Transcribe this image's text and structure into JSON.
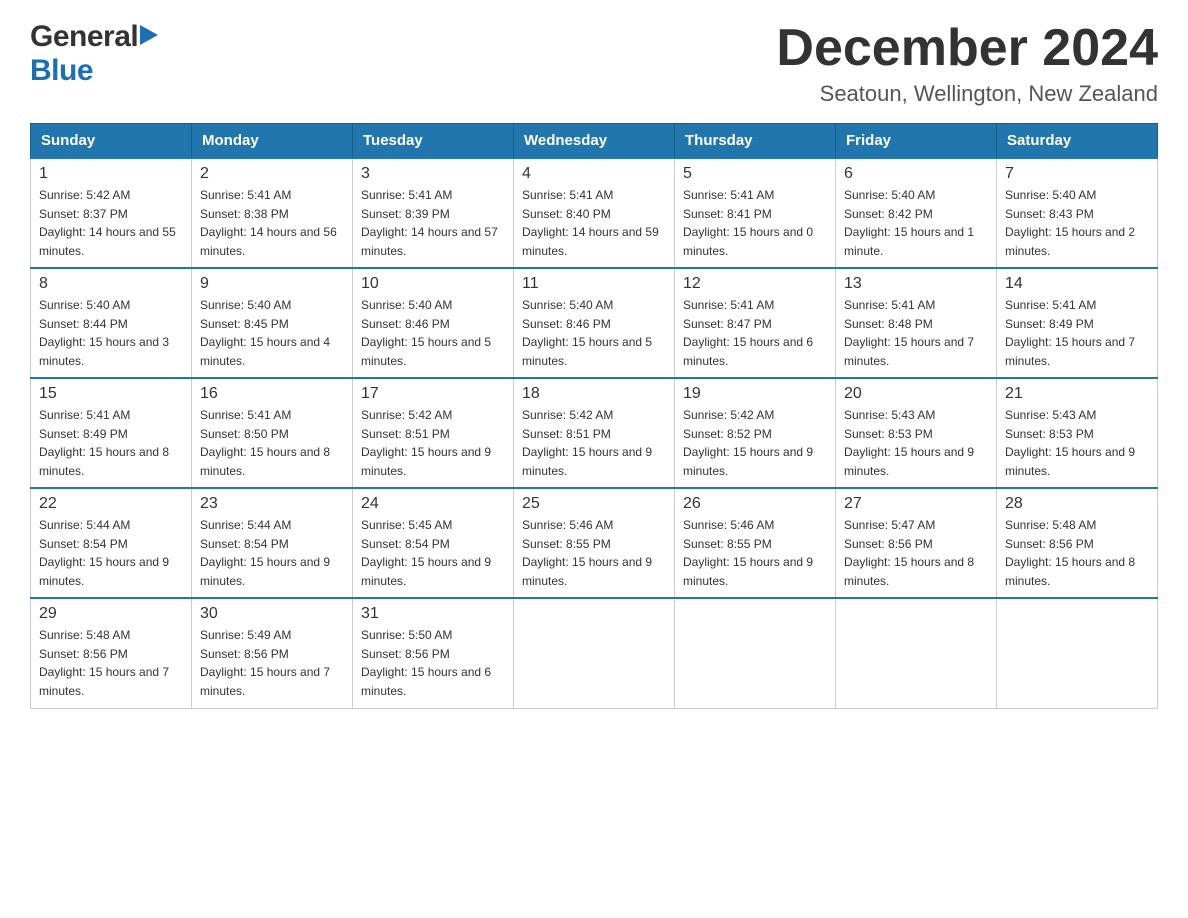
{
  "header": {
    "logo_general": "General",
    "logo_blue": "Blue",
    "month_title": "December 2024",
    "location": "Seatoun, Wellington, New Zealand"
  },
  "weekdays": [
    "Sunday",
    "Monday",
    "Tuesday",
    "Wednesday",
    "Thursday",
    "Friday",
    "Saturday"
  ],
  "weeks": [
    [
      {
        "day": "1",
        "sunrise": "5:42 AM",
        "sunset": "8:37 PM",
        "daylight": "14 hours and 55 minutes."
      },
      {
        "day": "2",
        "sunrise": "5:41 AM",
        "sunset": "8:38 PM",
        "daylight": "14 hours and 56 minutes."
      },
      {
        "day": "3",
        "sunrise": "5:41 AM",
        "sunset": "8:39 PM",
        "daylight": "14 hours and 57 minutes."
      },
      {
        "day": "4",
        "sunrise": "5:41 AM",
        "sunset": "8:40 PM",
        "daylight": "14 hours and 59 minutes."
      },
      {
        "day": "5",
        "sunrise": "5:41 AM",
        "sunset": "8:41 PM",
        "daylight": "15 hours and 0 minutes."
      },
      {
        "day": "6",
        "sunrise": "5:40 AM",
        "sunset": "8:42 PM",
        "daylight": "15 hours and 1 minute."
      },
      {
        "day": "7",
        "sunrise": "5:40 AM",
        "sunset": "8:43 PM",
        "daylight": "15 hours and 2 minutes."
      }
    ],
    [
      {
        "day": "8",
        "sunrise": "5:40 AM",
        "sunset": "8:44 PM",
        "daylight": "15 hours and 3 minutes."
      },
      {
        "day": "9",
        "sunrise": "5:40 AM",
        "sunset": "8:45 PM",
        "daylight": "15 hours and 4 minutes."
      },
      {
        "day": "10",
        "sunrise": "5:40 AM",
        "sunset": "8:46 PM",
        "daylight": "15 hours and 5 minutes."
      },
      {
        "day": "11",
        "sunrise": "5:40 AM",
        "sunset": "8:46 PM",
        "daylight": "15 hours and 5 minutes."
      },
      {
        "day": "12",
        "sunrise": "5:41 AM",
        "sunset": "8:47 PM",
        "daylight": "15 hours and 6 minutes."
      },
      {
        "day": "13",
        "sunrise": "5:41 AM",
        "sunset": "8:48 PM",
        "daylight": "15 hours and 7 minutes."
      },
      {
        "day": "14",
        "sunrise": "5:41 AM",
        "sunset": "8:49 PM",
        "daylight": "15 hours and 7 minutes."
      }
    ],
    [
      {
        "day": "15",
        "sunrise": "5:41 AM",
        "sunset": "8:49 PM",
        "daylight": "15 hours and 8 minutes."
      },
      {
        "day": "16",
        "sunrise": "5:41 AM",
        "sunset": "8:50 PM",
        "daylight": "15 hours and 8 minutes."
      },
      {
        "day": "17",
        "sunrise": "5:42 AM",
        "sunset": "8:51 PM",
        "daylight": "15 hours and 9 minutes."
      },
      {
        "day": "18",
        "sunrise": "5:42 AM",
        "sunset": "8:51 PM",
        "daylight": "15 hours and 9 minutes."
      },
      {
        "day": "19",
        "sunrise": "5:42 AM",
        "sunset": "8:52 PM",
        "daylight": "15 hours and 9 minutes."
      },
      {
        "day": "20",
        "sunrise": "5:43 AM",
        "sunset": "8:53 PM",
        "daylight": "15 hours and 9 minutes."
      },
      {
        "day": "21",
        "sunrise": "5:43 AM",
        "sunset": "8:53 PM",
        "daylight": "15 hours and 9 minutes."
      }
    ],
    [
      {
        "day": "22",
        "sunrise": "5:44 AM",
        "sunset": "8:54 PM",
        "daylight": "15 hours and 9 minutes."
      },
      {
        "day": "23",
        "sunrise": "5:44 AM",
        "sunset": "8:54 PM",
        "daylight": "15 hours and 9 minutes."
      },
      {
        "day": "24",
        "sunrise": "5:45 AM",
        "sunset": "8:54 PM",
        "daylight": "15 hours and 9 minutes."
      },
      {
        "day": "25",
        "sunrise": "5:46 AM",
        "sunset": "8:55 PM",
        "daylight": "15 hours and 9 minutes."
      },
      {
        "day": "26",
        "sunrise": "5:46 AM",
        "sunset": "8:55 PM",
        "daylight": "15 hours and 9 minutes."
      },
      {
        "day": "27",
        "sunrise": "5:47 AM",
        "sunset": "8:56 PM",
        "daylight": "15 hours and 8 minutes."
      },
      {
        "day": "28",
        "sunrise": "5:48 AM",
        "sunset": "8:56 PM",
        "daylight": "15 hours and 8 minutes."
      }
    ],
    [
      {
        "day": "29",
        "sunrise": "5:48 AM",
        "sunset": "8:56 PM",
        "daylight": "15 hours and 7 minutes."
      },
      {
        "day": "30",
        "sunrise": "5:49 AM",
        "sunset": "8:56 PM",
        "daylight": "15 hours and 7 minutes."
      },
      {
        "day": "31",
        "sunrise": "5:50 AM",
        "sunset": "8:56 PM",
        "daylight": "15 hours and 6 minutes."
      },
      null,
      null,
      null,
      null
    ]
  ]
}
